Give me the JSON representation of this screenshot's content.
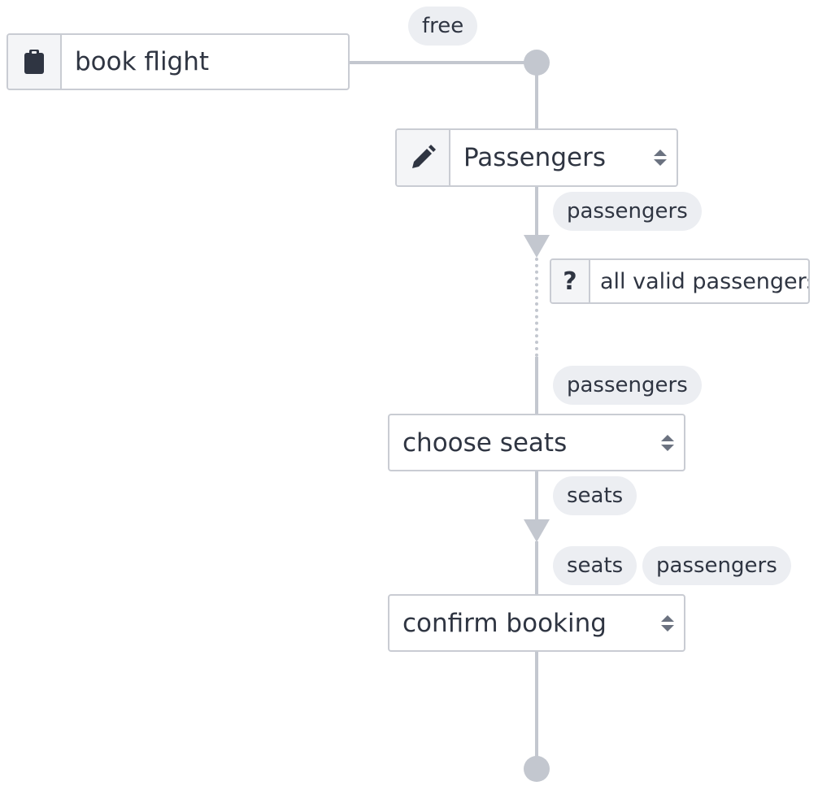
{
  "start": {
    "label": "book flight",
    "icon": "clipboard-icon",
    "edge_label": "free"
  },
  "steps": [
    {
      "label": "Passengers",
      "icon": "pencil-icon",
      "output_tags": [
        "passengers"
      ]
    },
    {
      "condition_icon": "question-icon",
      "condition_label": "all valid passengers"
    },
    {
      "input_tags": [
        "passengers"
      ],
      "label": "choose seats",
      "output_tags": [
        "seats"
      ]
    },
    {
      "input_tags": [
        "seats",
        "passengers"
      ],
      "label": "confirm booking"
    }
  ],
  "colors": {
    "line": "#c3c7cf",
    "pill_bg": "#eceef2",
    "border": "#c9ccd3",
    "text": "#2f3542"
  }
}
